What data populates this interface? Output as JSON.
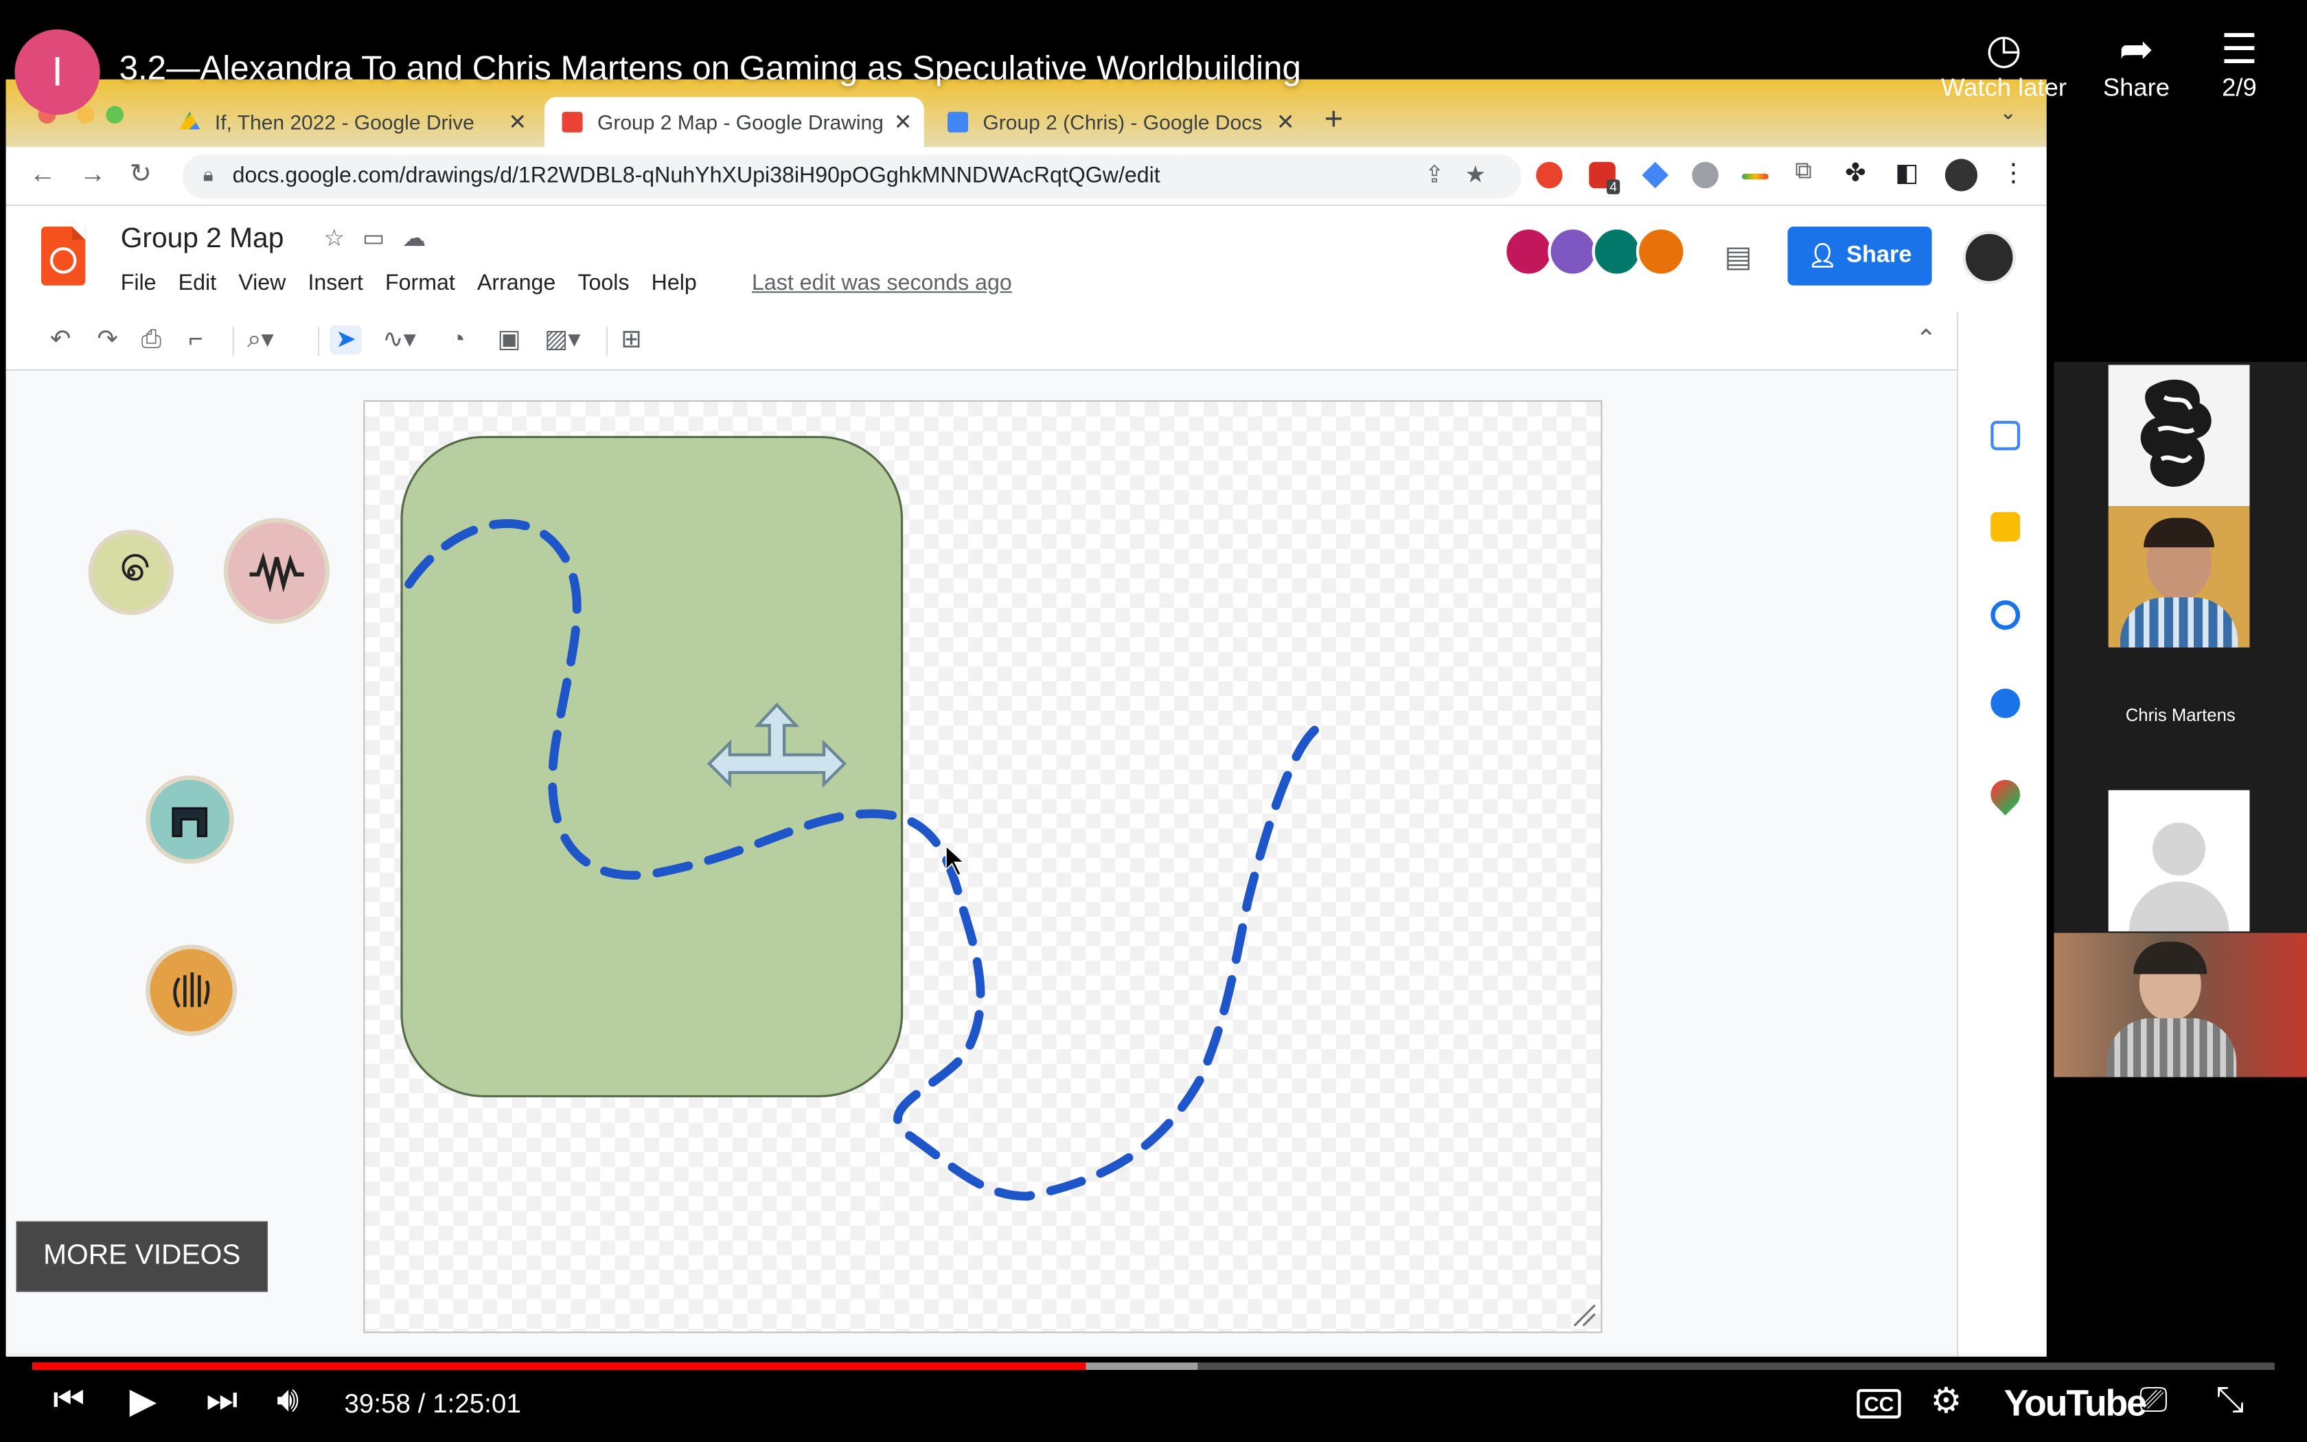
{
  "youtube": {
    "channel_initial": "I",
    "video_title": "3.2—Alexandra To and Chris Martens on Gaming as Speculative Worldbuilding",
    "watch_later_label": "Watch later",
    "share_label": "Share",
    "playlist_position": "2/9",
    "more_videos_label": "MORE VIDEOS",
    "current_time": "39:58",
    "duration": "1:25:01",
    "time_display": "39:58 / 1:25:01",
    "played_fraction": 0.47,
    "loaded_fraction": 0.52,
    "logo_text": "YouTube",
    "accent_color": "#ff0000"
  },
  "browser": {
    "tabs": [
      {
        "label": "If, Then 2022 - Google Drive",
        "icon": "google-drive-icon",
        "active": false
      },
      {
        "label": "Group 2 Map - Google Drawing",
        "icon": "google-drawings-icon",
        "active": true
      },
      {
        "label": "Group 2 (Chris) - Google Docs",
        "icon": "google-docs-icon",
        "active": false
      }
    ],
    "url": "docs.google.com/drawings/d/1R2WDBL8-qNuhYhXUpi38iH90pOGghkMNNDWAcRqtQGw/edit",
    "extension_badge": "4"
  },
  "app": {
    "doc_title": "Group 2 Map",
    "menu": [
      "File",
      "Edit",
      "View",
      "Insert",
      "Format",
      "Arrange",
      "Tools",
      "Help"
    ],
    "last_edit": "Last edit was seconds ago",
    "share_button": "Share",
    "brand_color": "#1a73e8"
  },
  "canvas": {
    "region_fill": "#b7cfa0",
    "path_color": "#1e55c8",
    "tokens": [
      "spiral-token",
      "zigzag-token",
      "gate-token",
      "hand-token"
    ]
  },
  "participants": {
    "named_participant": "Chris Martens"
  }
}
